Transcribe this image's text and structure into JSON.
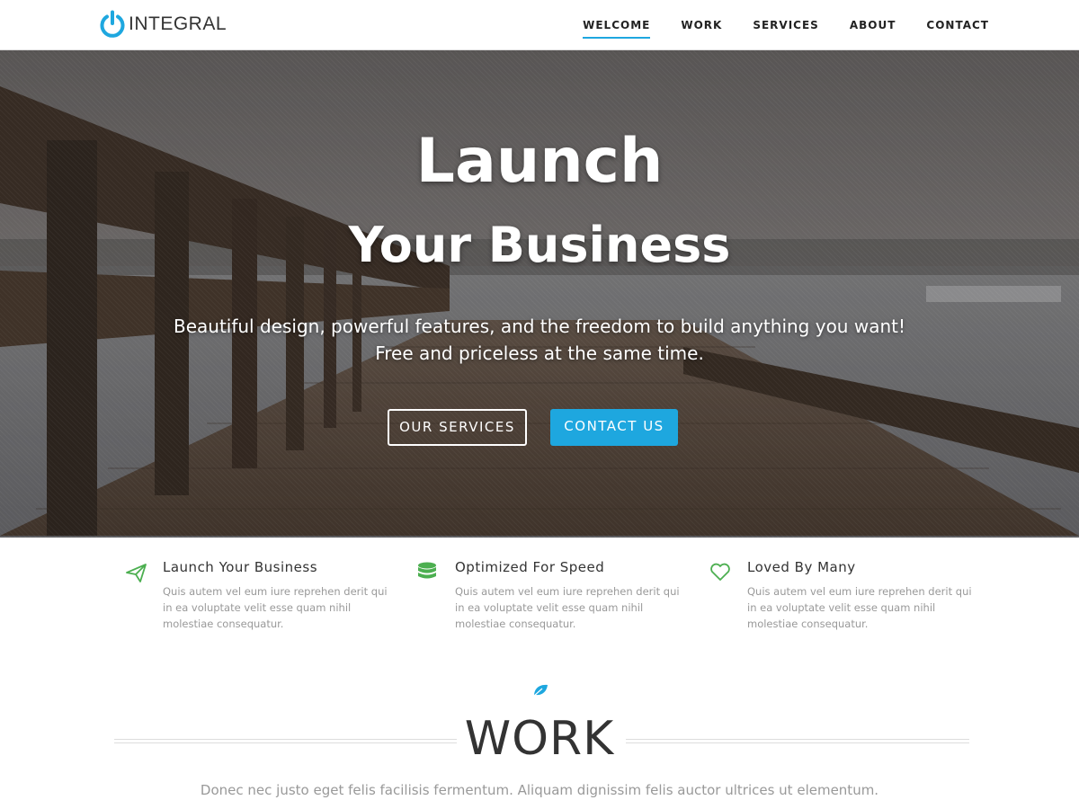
{
  "brand": {
    "name": "INTEGRAL",
    "accent_color": "#1ea7df",
    "icon": "power-icon"
  },
  "nav": {
    "items": [
      {
        "label": "WELCOME",
        "active": true
      },
      {
        "label": "WORK",
        "active": false
      },
      {
        "label": "SERVICES",
        "active": false
      },
      {
        "label": "ABOUT",
        "active": false
      },
      {
        "label": "CONTACT",
        "active": false
      }
    ]
  },
  "hero": {
    "title_line1": "Launch",
    "title_line2": "Your Business",
    "subtitle_line1": "Beautiful design, powerful features, and the freedom to build anything you want!",
    "subtitle_line2": "Free and priceless at the same time.",
    "button_outline": "OUR SERVICES",
    "button_solid": "CONTACT US"
  },
  "features": [
    {
      "icon": "paper-plane-icon",
      "title": "Launch Your Business",
      "text": "Quis autem vel eum iure reprehen derit qui in ea voluptate velit esse quam nihil molestiae consequatur."
    },
    {
      "icon": "database-icon",
      "title": "Optimized For Speed",
      "text": "Quis autem vel eum iure reprehen derit qui in ea voluptate velit esse quam nihil molestiae consequatur."
    },
    {
      "icon": "heart-icon",
      "title": "Loved By Many",
      "text": "Quis autem vel eum iure reprehen derit qui in ea voluptate velit esse quam nihil molestiae consequatur."
    }
  ],
  "feature_icon_color": "#4caf50",
  "work": {
    "icon": "leaf-icon",
    "title": "WORK",
    "subtitle": "Donec nec justo eget felis facilisis fermentum. Aliquam dignissim felis auctor ultrices ut elementum."
  }
}
